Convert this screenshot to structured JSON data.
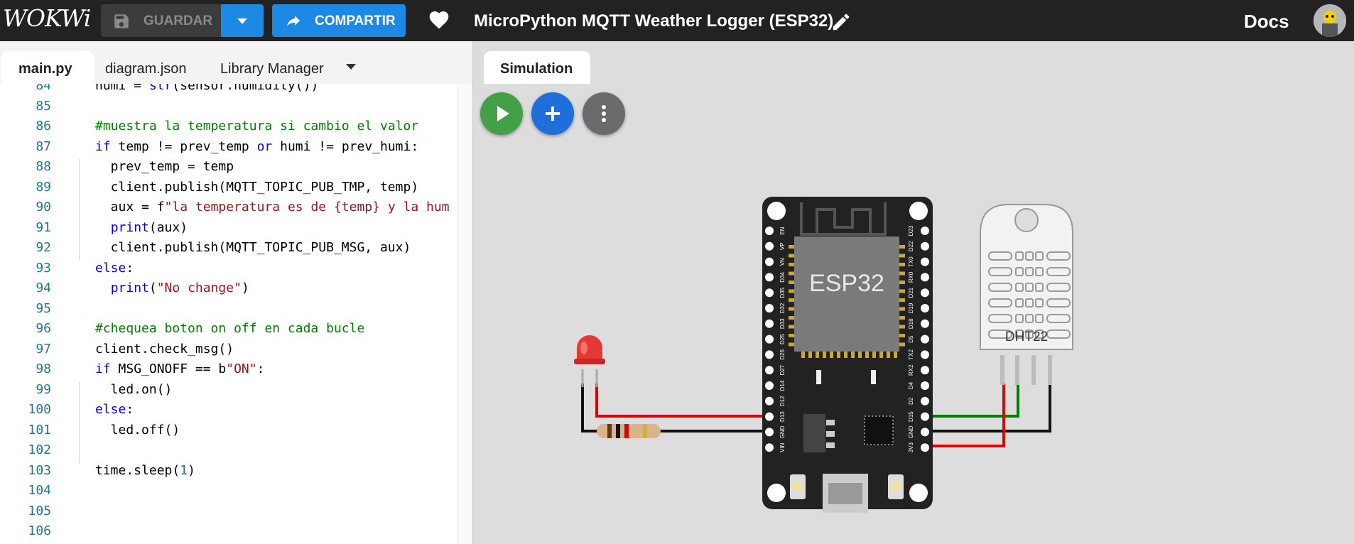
{
  "header": {
    "logo": "WOKWi",
    "save_label": "GUARDAR",
    "share_label": "COMPARTIR",
    "project_title": "MicroPython MQTT Weather Logger (ESP32)",
    "docs_label": "Docs"
  },
  "editor": {
    "tabs": [
      "main.py",
      "diagram.json",
      "Library Manager"
    ],
    "active_tab": "main.py"
  },
  "code_lines": [
    {
      "n": "84",
      "t": "humi = str(sensor.humidity())"
    },
    {
      "n": "85",
      "t": ""
    },
    {
      "n": "86",
      "t": "#muestra la temperatura si cambio el valor"
    },
    {
      "n": "87",
      "t": "if temp != prev_temp or humi != prev_humi:"
    },
    {
      "n": "88",
      "t": "  prev_temp = temp"
    },
    {
      "n": "89",
      "t": "  client.publish(MQTT_TOPIC_PUB_TMP, temp)"
    },
    {
      "n": "90",
      "t": "  aux = f\"la temperatura es de {temp} y la hum"
    },
    {
      "n": "91",
      "t": "  print(aux)"
    },
    {
      "n": "92",
      "t": "  client.publish(MQTT_TOPIC_PUB_MSG, aux)"
    },
    {
      "n": "93",
      "t": "else:"
    },
    {
      "n": "94",
      "t": "  print(\"No change\")"
    },
    {
      "n": "95",
      "t": ""
    },
    {
      "n": "96",
      "t": "#chequea boton on off en cada bucle"
    },
    {
      "n": "97",
      "t": "client.check_msg()"
    },
    {
      "n": "98",
      "t": "if MSG_ONOFF == b\"ON\":"
    },
    {
      "n": "99",
      "t": "  led.on()"
    },
    {
      "n": "100",
      "t": "else:"
    },
    {
      "n": "101",
      "t": "  led.off()"
    },
    {
      "n": "102",
      "t": ""
    },
    {
      "n": "103",
      "t": "time.sleep(1)"
    },
    {
      "n": "104",
      "t": ""
    },
    {
      "n": "105",
      "t": ""
    },
    {
      "n": "106",
      "t": ""
    }
  ],
  "simulation": {
    "tab_label": "Simulation",
    "board_label": "ESP32",
    "sensor_label": "DHT22",
    "left_pins": [
      "EN",
      "VP",
      "VN",
      "D34",
      "D35",
      "D32",
      "D33",
      "D25",
      "D26",
      "D27",
      "D14",
      "D12",
      "D13",
      "GND",
      "VIN"
    ],
    "right_pins": [
      "D23",
      "D22",
      "TX0",
      "RX0",
      "D21",
      "D19",
      "D18",
      "D5",
      "TX2",
      "RX2",
      "D4",
      "D2",
      "D15",
      "GND",
      "3V3"
    ]
  },
  "colors": {
    "accent": "#1e88e5",
    "play": "#43a047",
    "header_bg": "#222222",
    "wire_red": "#e00000",
    "wire_green": "#008000"
  }
}
